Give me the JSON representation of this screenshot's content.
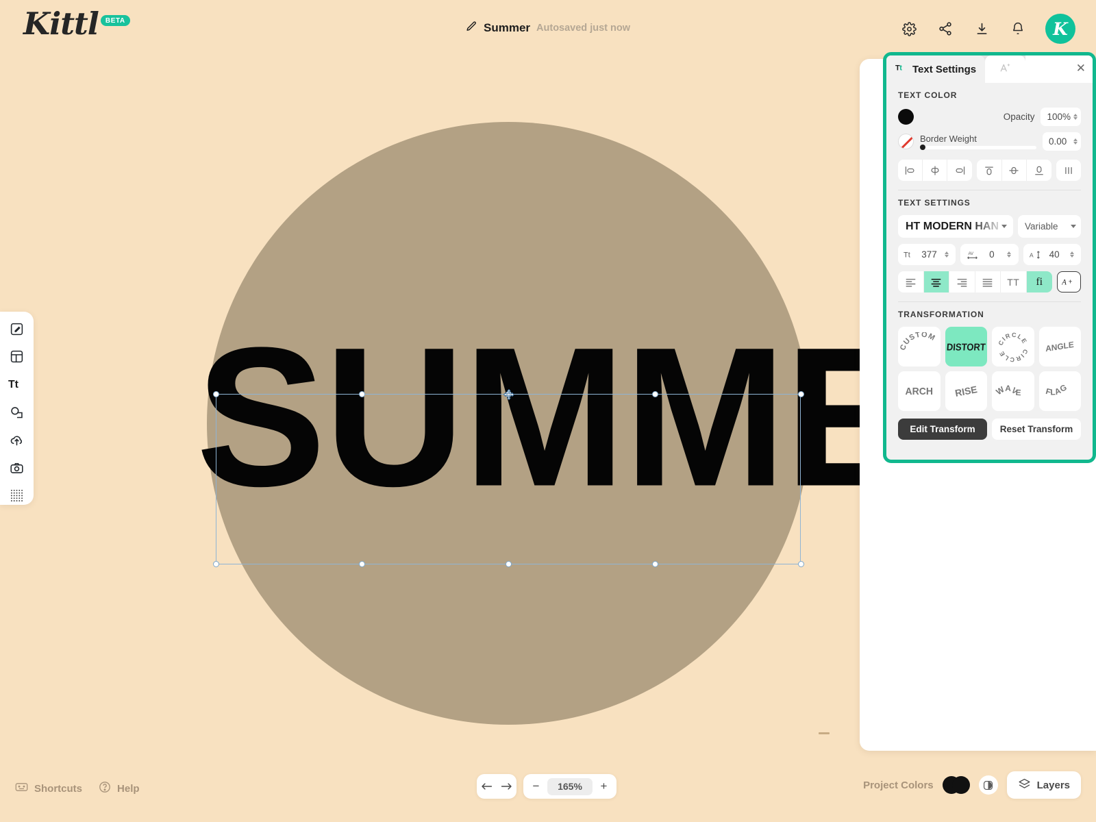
{
  "app": {
    "brand": "Kittl",
    "brand_badge": "BETA",
    "background_color": "#F8E1C0",
    "accent_color": "#11B88E",
    "highlight_color": "#8EE8C8"
  },
  "header": {
    "document_title": "Summer",
    "autosave_status": "Autosaved just now",
    "edit_icon": "pencil-icon",
    "actions": [
      {
        "name": "settings",
        "icon": "gear-icon"
      },
      {
        "name": "share",
        "icon": "share-icon"
      },
      {
        "name": "download",
        "icon": "download-icon"
      },
      {
        "name": "notifications",
        "icon": "bell-icon"
      }
    ],
    "avatar_initial": "K"
  },
  "left_toolbar": {
    "items": [
      {
        "name": "design",
        "icon": "pencil-square-icon"
      },
      {
        "name": "templates",
        "icon": "layout-icon"
      },
      {
        "name": "text",
        "icon": "text-tt-icon"
      },
      {
        "name": "elements",
        "icon": "shapes-icon"
      },
      {
        "name": "uploads",
        "icon": "upload-cloud-icon"
      },
      {
        "name": "photos",
        "icon": "camera-icon"
      },
      {
        "name": "patterns",
        "icon": "dots-grid-icon"
      }
    ]
  },
  "canvas": {
    "artwork_text": "SUMMER",
    "circle_color": "#B3A184",
    "text_color": "#050505"
  },
  "right_panel": {
    "tabs": [
      {
        "label": "Text Settings",
        "icon": "text-tt-icon",
        "active": true
      },
      {
        "label": "",
        "icon": "magic-text-icon",
        "active": false
      }
    ],
    "close_icon": "close-icon",
    "text_color": {
      "section_label": "TEXT COLOR",
      "swatch": "#0B0B0B",
      "opacity_label": "Opacity",
      "opacity_value": "100%",
      "border_weight_label": "Border Weight",
      "border_weight_value": "0.00",
      "border_swatch_icon": "no-color-icon"
    },
    "align_icons": [
      {
        "name": "align-left-icon"
      },
      {
        "name": "align-center-horizontal-icon"
      },
      {
        "name": "align-right-icon"
      },
      {
        "name": "align-top-icon"
      },
      {
        "name": "align-middle-vertical-icon"
      },
      {
        "name": "align-bottom-icon"
      },
      {
        "name": "distribute-icon"
      }
    ],
    "text_settings": {
      "section_label": "TEXT SETTINGS",
      "font_family": "HT MODERN HAN",
      "font_variant": "Variable",
      "font_size_icon": "font-size-icon",
      "font_size": "377",
      "letter_spacing_icon": "letter-spacing-icon",
      "letter_spacing": "0",
      "line_height_icon": "line-height-icon",
      "line_height": "40",
      "alignment_buttons": [
        {
          "name": "text-align-left-icon",
          "active": false
        },
        {
          "name": "text-align-center-icon",
          "active": true
        },
        {
          "name": "text-align-right-icon",
          "active": false
        },
        {
          "name": "text-align-justify-icon",
          "active": false
        },
        {
          "name": "uppercase-icon",
          "label": "TT",
          "active": false
        },
        {
          "name": "ligature-icon",
          "label": "fi",
          "active": true
        }
      ],
      "add_text_effect_label": "A+"
    },
    "transformation": {
      "section_label": "TRANSFORMATION",
      "options": [
        {
          "label": "CUSTOM",
          "active": false
        },
        {
          "label": "DISTORT",
          "active": true
        },
        {
          "label": "CIRCLE",
          "active": false
        },
        {
          "label": "ANGLE",
          "active": false
        },
        {
          "label": "ARCH",
          "active": false
        },
        {
          "label": "RISE",
          "active": false
        },
        {
          "label": "WAVE",
          "active": false
        },
        {
          "label": "FLAG",
          "active": false
        }
      ],
      "edit_transform_label": "Edit Transform",
      "reset_transform_label": "Reset Transform"
    }
  },
  "footer": {
    "shortcuts_label": "Shortcuts",
    "help_label": "Help",
    "undo_icon": "undo-arrow-icon",
    "redo_icon": "redo-arrow-icon",
    "zoom_out_label": "−",
    "zoom_value": "165%",
    "zoom_in_label": "+",
    "project_colors_label": "Project Colors",
    "project_colors": [
      "#111111",
      "#111111"
    ],
    "palette_icon": "palette-icon",
    "layers_label": "Layers",
    "layers_icon": "layers-icon"
  }
}
